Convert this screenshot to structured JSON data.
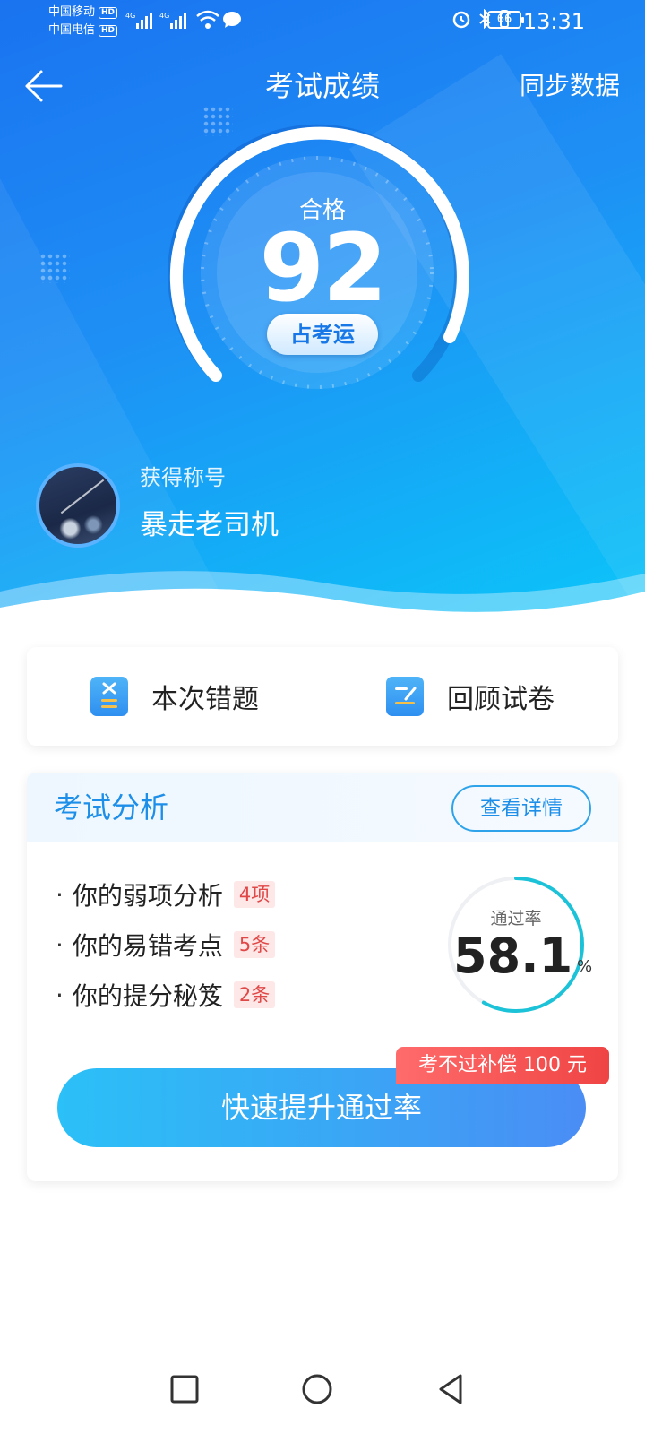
{
  "status_bar": {
    "carrier1": "中国移动",
    "carrier2": "中国电信",
    "hd": "HD",
    "net1": "4G",
    "net2": "4G",
    "battery": "66",
    "time": "13:31"
  },
  "nav": {
    "title": "考试成绩",
    "sync": "同步数据"
  },
  "score": {
    "status": "合格",
    "value": "92",
    "fortune_button": "占考运"
  },
  "badge": {
    "label": "获得称号",
    "name": "暴走老司机"
  },
  "actions": {
    "wrong": "本次错题",
    "review": "回顾试卷"
  },
  "analysis": {
    "title": "考试分析",
    "detail_button": "查看详情",
    "items": [
      {
        "dot": "·",
        "text": "你的弱项分析",
        "tag": "4项"
      },
      {
        "dot": "·",
        "text": "你的易错考点",
        "tag": "5条"
      },
      {
        "dot": "·",
        "text": "你的提分秘笈",
        "tag": "2条"
      }
    ],
    "pass_rate_label": "通过率",
    "pass_rate": "58.1",
    "pass_rate_fraction": 0.581,
    "pass_rate_unit": "%",
    "promo": "考不过补偿 100 元",
    "cta": "快速提升通过率"
  },
  "colors": {
    "accent": "#1d8fe8",
    "tag_red": "#e04848"
  },
  "icons": [
    "back-arrow-icon",
    "alarm-icon",
    "bluetooth-icon",
    "wrong-questions-icon",
    "review-paper-icon",
    "square-nav-icon",
    "circle-nav-icon",
    "triangle-back-nav-icon"
  ]
}
